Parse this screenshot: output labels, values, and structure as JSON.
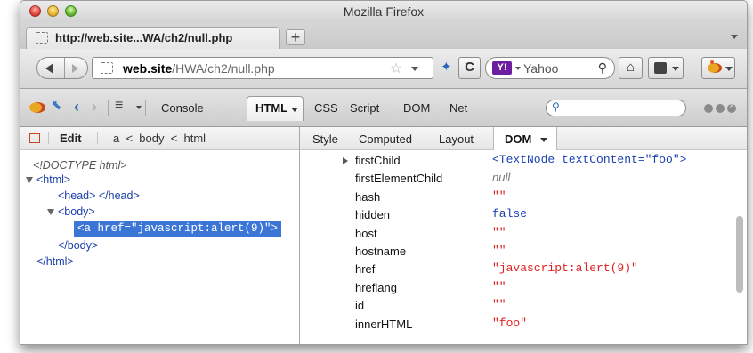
{
  "window": {
    "title": "Mozilla Firefox"
  },
  "tab": {
    "label": "http://web.site...WA/ch2/null.php"
  },
  "newtab": {
    "label": "+"
  },
  "urlbar": {
    "host": "web.site",
    "path": "/HWA/ch2/null.php"
  },
  "nav": {
    "reload_glyph": "C",
    "home_glyph": "⌂"
  },
  "search": {
    "engine_logo": "Y!",
    "placeholder": "Yahoo"
  },
  "firebug": {
    "panels": [
      "Console",
      "HTML",
      "CSS",
      "Script",
      "DOM",
      "Net"
    ],
    "active_panel": "HTML"
  },
  "breadcrumb": {
    "edit_label": "Edit",
    "path": "a  <  body  <  html"
  },
  "tree": {
    "doctype": "<!DOCTYPE html>",
    "html_open": "<html>",
    "head": "<head> </head>",
    "body_open": "<body>",
    "selected": "<a href=\"javascript:alert(9)\">",
    "body_close": "</body>",
    "html_close": "</html>"
  },
  "side_tabs": [
    "Style",
    "Computed",
    "Layout",
    "DOM"
  ],
  "active_side_tab": "DOM",
  "properties": [
    {
      "name": "firstChild",
      "value": "<TextNode textContent=\"foo\">",
      "kind": "node",
      "expandable": true
    },
    {
      "name": "firstElementChild",
      "value": "null",
      "kind": "null",
      "expandable": false
    },
    {
      "name": "hash",
      "value": "\"\"",
      "kind": "string",
      "expandable": false
    },
    {
      "name": "hidden",
      "value": "false",
      "kind": "bool",
      "expandable": false
    },
    {
      "name": "host",
      "value": "\"\"",
      "kind": "string",
      "expandable": false
    },
    {
      "name": "hostname",
      "value": "\"\"",
      "kind": "string",
      "expandable": false
    },
    {
      "name": "href",
      "value": "\"javascript:alert(9)\"",
      "kind": "string",
      "expandable": false
    },
    {
      "name": "hreflang",
      "value": "\"\"",
      "kind": "string",
      "expandable": false
    },
    {
      "name": "id",
      "value": "\"\"",
      "kind": "string",
      "expandable": false
    },
    {
      "name": "innerHTML",
      "value": "\"foo\"",
      "kind": "string",
      "expandable": false
    }
  ]
}
